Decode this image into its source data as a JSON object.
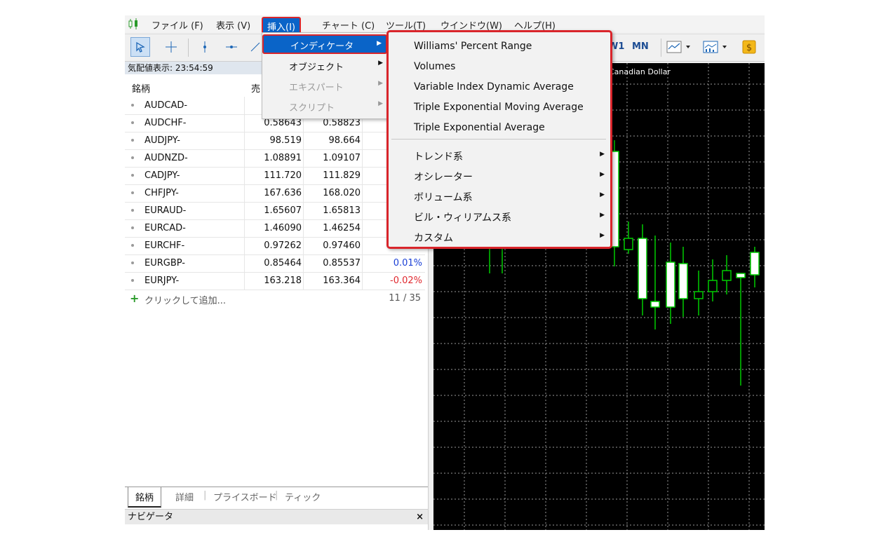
{
  "menubar": {
    "items": [
      "ファイル (F)",
      "表示 (V)",
      "挿入(I)",
      "チャート (C)",
      "ツール(T)",
      "ウインドウ(W)",
      "ヘルプ(H)"
    ]
  },
  "toolbar": {
    "timeframes": [
      "W1",
      "MN"
    ]
  },
  "market_watch": {
    "title": "気配値表示: 23:54:59",
    "headers": {
      "symbol": "銘柄",
      "bid": "売"
    },
    "rows": [
      {
        "symbol": "AUDCAD-",
        "bid": "",
        "ask": "",
        "change": ""
      },
      {
        "symbol": "AUDCHF-",
        "bid": "0.58643",
        "ask": "0.58823",
        "change": ""
      },
      {
        "symbol": "AUDJPY-",
        "bid": "98.519",
        "ask": "98.664",
        "change": ""
      },
      {
        "symbol": "AUDNZD-",
        "bid": "1.08891",
        "ask": "1.09107",
        "change": ""
      },
      {
        "symbol": "CADJPY-",
        "bid": "111.720",
        "ask": "111.829",
        "change": ""
      },
      {
        "symbol": "CHFJPY-",
        "bid": "167.636",
        "ask": "168.020",
        "change": ""
      },
      {
        "symbol": "EURAUD-",
        "bid": "1.65607",
        "ask": "1.65813",
        "change": ""
      },
      {
        "symbol": "EURCAD-",
        "bid": "1.46090",
        "ask": "1.46254",
        "change": ""
      },
      {
        "symbol": "EURCHF-",
        "bid": "0.97262",
        "ask": "0.97460",
        "change": ""
      },
      {
        "symbol": "EURGBP-",
        "bid": "0.85464",
        "ask": "0.85537",
        "change": "0.01%"
      },
      {
        "symbol": "EURJPY-",
        "bid": "163.218",
        "ask": "163.364",
        "change": "-0.02%"
      }
    ],
    "add_label": "クリックして追加...",
    "count": "11 / 35",
    "tabs": [
      "銘柄",
      "詳細",
      "プライスボード",
      "ティック"
    ]
  },
  "navigator": {
    "title": "ナビゲータ",
    "close": "×"
  },
  "chart": {
    "title": "Canadian Dollar"
  },
  "insert_menu": {
    "items": [
      {
        "label": "インディケータ",
        "disabled": false
      },
      {
        "label": "オブジェクト",
        "disabled": false
      },
      {
        "label": "エキスパート",
        "disabled": true
      },
      {
        "label": "スクリプト",
        "disabled": true
      }
    ]
  },
  "indicator_menu": {
    "recent": [
      "Williams' Percent Range",
      "Volumes",
      "Variable Index Dynamic Average",
      "Triple Exponential Moving Average",
      "Triple Exponential Average"
    ],
    "groups": [
      "トレンド系",
      "オシレーター",
      "ボリューム系",
      "ビル・ウィリアムス系",
      "カスタム"
    ]
  },
  "colors": {
    "accent": "#0a64c8",
    "highlight_border": "#d9252b",
    "positive": "#1a3fd6",
    "negative": "#e0282e",
    "candle": "#00cc00"
  }
}
